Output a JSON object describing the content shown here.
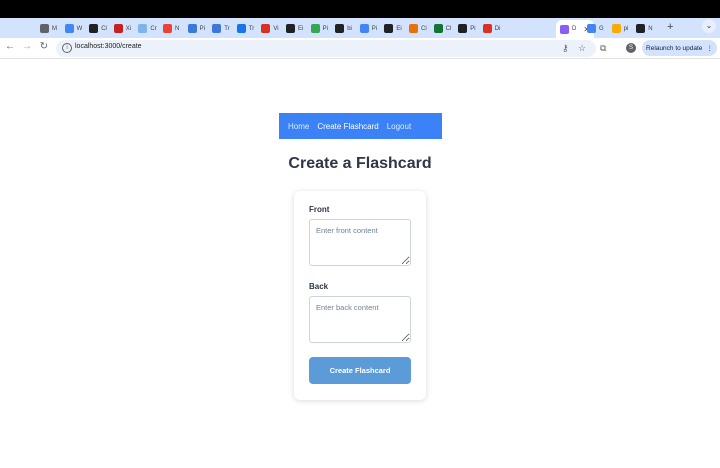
{
  "browser": {
    "tabs": [
      {
        "label": "M",
        "color": "#5f6368"
      },
      {
        "label": "W",
        "color": "#4285f4"
      },
      {
        "label": "Cl",
        "color": "#202124"
      },
      {
        "label": "Xi",
        "color": "#c5221f"
      },
      {
        "label": "Cr",
        "color": "#7fb3f0"
      },
      {
        "label": "N",
        "color": "#ea4335"
      },
      {
        "label": "Pi",
        "color": "#3c78d8"
      },
      {
        "label": "Tr",
        "color": "#3c78d8"
      },
      {
        "label": "Tr",
        "color": "#1a73e8"
      },
      {
        "label": "Vi",
        "color": "#d93025"
      },
      {
        "label": "Ei",
        "color": "#202124"
      },
      {
        "label": "Pi",
        "color": "#34a853"
      },
      {
        "label": "bi",
        "color": "#202124"
      },
      {
        "label": "Pi",
        "color": "#4285f4"
      },
      {
        "label": "Ei",
        "color": "#202124"
      },
      {
        "label": "Cl",
        "color": "#e8710a"
      },
      {
        "label": "Cl",
        "color": "#137333"
      },
      {
        "label": "Pi",
        "color": "#202124"
      },
      {
        "label": "Di",
        "color": "#d93025"
      }
    ],
    "active_tab": {
      "label": "D",
      "color": "#8b5cf6"
    },
    "trailing_tabs": [
      {
        "label": "G",
        "color": "#4285f4"
      },
      {
        "label": "pi",
        "color": "#f9ab00"
      },
      {
        "label": "N",
        "color": "#202124"
      }
    ],
    "url": "localhost:3000/create",
    "relaunch_label": "Relaunch to update",
    "profile_initial": "S"
  },
  "nav": {
    "home": "Home",
    "create": "Create Flashcard",
    "logout": "Logout"
  },
  "form": {
    "title": "Create a Flashcard",
    "front_label": "Front",
    "front_placeholder": "Enter front content",
    "back_label": "Back",
    "back_placeholder": "Enter back content",
    "submit_label": "Create Flashcard"
  }
}
